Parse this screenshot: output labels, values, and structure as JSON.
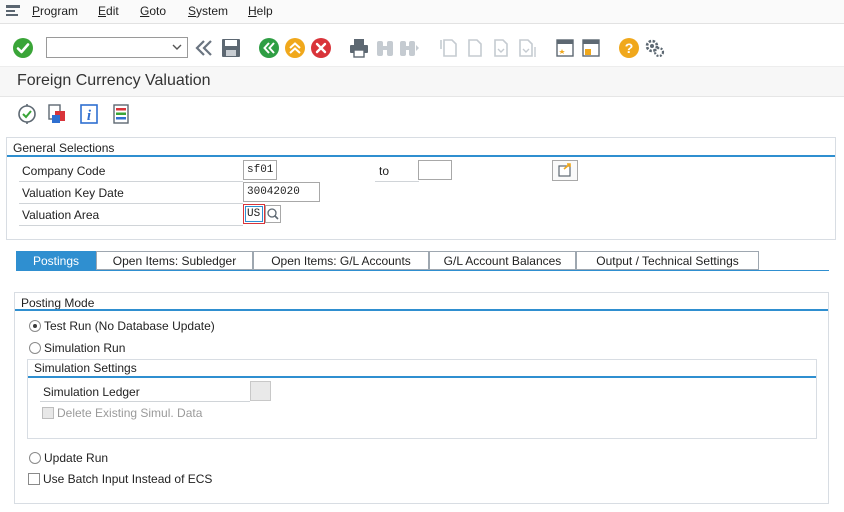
{
  "menu": {
    "items": [
      {
        "label": "Program",
        "accel": "P",
        "rest": "rogram"
      },
      {
        "label": "Edit",
        "accel": "E",
        "rest": "dit"
      },
      {
        "label": "Goto",
        "accel": "G",
        "rest": "oto"
      },
      {
        "label": "System",
        "accel": "S",
        "rest": "ystem"
      },
      {
        "label": "Help",
        "accel": "H",
        "rest": "elp"
      }
    ]
  },
  "toolbar": {
    "command_field_value": "",
    "icons": [
      "enter-icon",
      "back-chevrons-icon",
      "save-icon",
      "back-icon",
      "exit-icon",
      "cancel-icon",
      "print-icon",
      "find-icon",
      "find-next-icon",
      "first-page-icon",
      "previous-page-icon",
      "next-page-icon",
      "last-page-icon",
      "create-session-icon",
      "shortcut-icon",
      "help-icon",
      "customize-layout-icon"
    ]
  },
  "page": {
    "title": "Foreign Currency Valuation"
  },
  "app_toolbar": {
    "icons": [
      "execute-icon",
      "get-variant-icon",
      "program-info-icon",
      "selection-options-icon"
    ]
  },
  "general_selections": {
    "title": "General Selections",
    "company_code_label": "Company Code",
    "company_code_value": "sf01",
    "to_label": "to",
    "to_value": "",
    "valuation_key_date_label": "Valuation Key Date",
    "valuation_key_date_value": "30042020",
    "valuation_area_label": "Valuation Area",
    "valuation_area_value": "US"
  },
  "tabs": [
    {
      "label": "Postings",
      "active": true
    },
    {
      "label": "Open Items: Subledger",
      "active": false
    },
    {
      "label": "Open Items: G/L Accounts",
      "active": false
    },
    {
      "label": "G/L Account Balances",
      "active": false
    },
    {
      "label": "Output / Technical Settings",
      "active": false
    }
  ],
  "posting_mode": {
    "title": "Posting Mode",
    "test_run_label": "Test Run (No Database Update)",
    "simulation_run_label": "Simulation Run",
    "simulation_settings_title": "Simulation Settings",
    "simulation_ledger_label": "Simulation Ledger",
    "simulation_ledger_value": "",
    "delete_existing_label": "Delete Existing Simul. Data",
    "update_run_label": "Update Run",
    "batch_input_label": "Use Batch Input Instead of ECS",
    "selected": "test_run"
  },
  "colors": {
    "accent": "#2f8fd0",
    "enter_green": "#3aa538",
    "back_green": "#2f9e44",
    "exit_orange": "#f0a81c",
    "cancel_red": "#d9343a",
    "help_orange": "#f0a81c"
  }
}
